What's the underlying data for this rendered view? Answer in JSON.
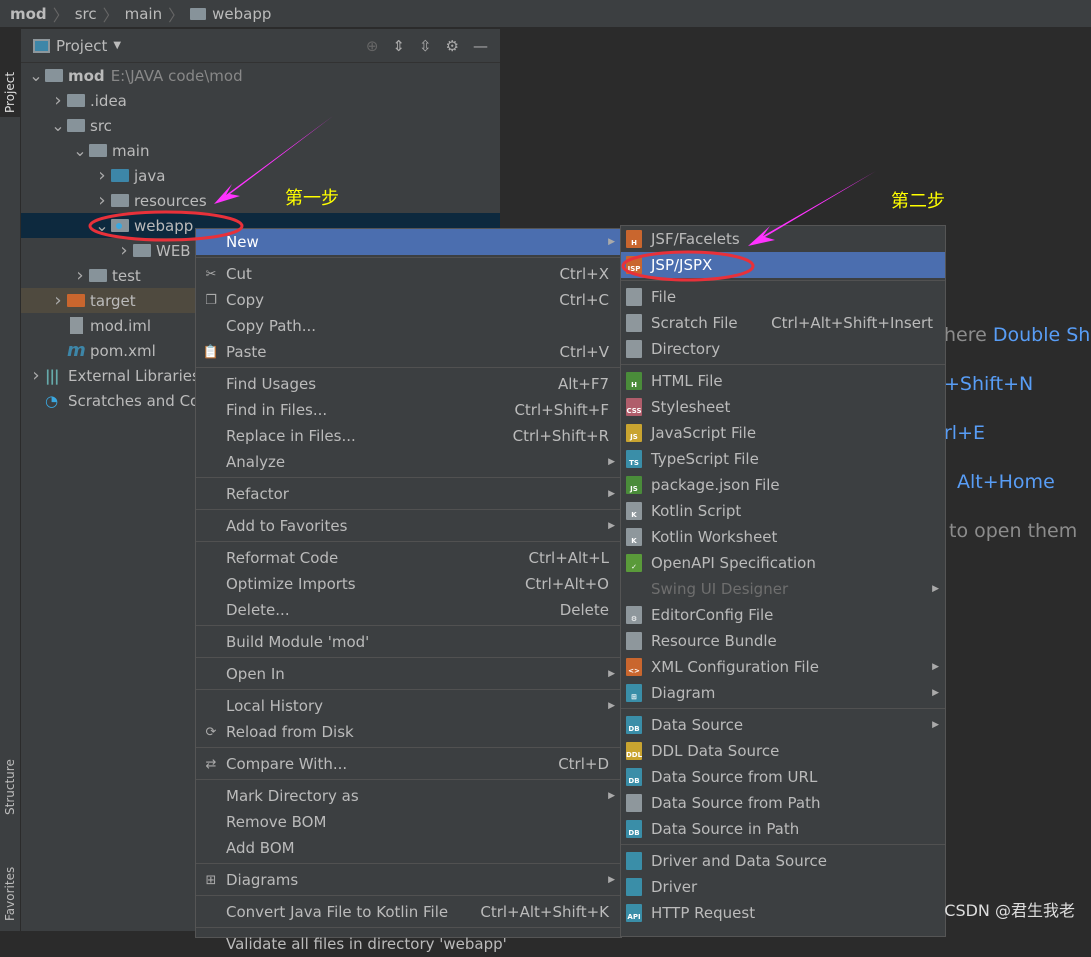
{
  "breadcrumb": [
    "mod",
    "src",
    "main",
    "webapp"
  ],
  "left_stripe": {
    "project": "Project",
    "structure": "Structure",
    "favorites": "Favorites"
  },
  "panel": {
    "title": "Project",
    "tools": [
      "locate-icon",
      "expand-all-icon",
      "collapse-all-icon",
      "gear-icon",
      "minimize-icon"
    ]
  },
  "tree": [
    {
      "label": "mod",
      "extra": "E:\\JAVA code\\mod",
      "indent": 0,
      "arrow": "down",
      "icon": "module",
      "bold": true
    },
    {
      "label": ".idea",
      "indent": 1,
      "arrow": "right",
      "icon": "folder"
    },
    {
      "label": "src",
      "indent": 1,
      "arrow": "down",
      "icon": "folder"
    },
    {
      "label": "main",
      "indent": 2,
      "arrow": "down",
      "icon": "folder"
    },
    {
      "label": "java",
      "indent": 3,
      "arrow": "right",
      "icon": "folder-blue"
    },
    {
      "label": "resources",
      "indent": 3,
      "arrow": "right",
      "icon": "folder"
    },
    {
      "label": "webapp",
      "indent": 3,
      "arrow": "down",
      "icon": "folder-web",
      "selected": true
    },
    {
      "label": "WEB",
      "indent": 4,
      "arrow": "right",
      "icon": "folder"
    },
    {
      "label": "test",
      "indent": 2,
      "arrow": "right",
      "icon": "folder"
    },
    {
      "label": "target",
      "indent": 1,
      "arrow": "right",
      "icon": "folder-orange",
      "excluded": true
    },
    {
      "label": "mod.iml",
      "indent": 1,
      "arrow": "",
      "icon": "file"
    },
    {
      "label": "pom.xml",
      "indent": 1,
      "arrow": "",
      "icon": "maven"
    },
    {
      "label": "External Libraries",
      "indent": 0,
      "arrow": "right",
      "icon": "libraries"
    },
    {
      "label": "Scratches and Co",
      "indent": 0,
      "arrow": "",
      "icon": "scratches"
    }
  ],
  "context_menu": [
    {
      "label": "New",
      "submenu": true,
      "highlighted": true
    },
    "sep",
    {
      "label": "Cut",
      "shortcut": "Ctrl+X",
      "icon": "✂"
    },
    {
      "label": "Copy",
      "shortcut": "Ctrl+C",
      "icon": "❐"
    },
    {
      "label": "Copy Path...",
      "shortcut": ""
    },
    {
      "label": "Paste",
      "shortcut": "Ctrl+V",
      "icon": "📋"
    },
    "sep",
    {
      "label": "Find Usages",
      "shortcut": "Alt+F7"
    },
    {
      "label": "Find in Files...",
      "shortcut": "Ctrl+Shift+F"
    },
    {
      "label": "Replace in Files...",
      "shortcut": "Ctrl+Shift+R"
    },
    {
      "label": "Analyze",
      "submenu": true
    },
    "sep",
    {
      "label": "Refactor",
      "submenu": true
    },
    "sep",
    {
      "label": "Add to Favorites",
      "submenu": true
    },
    "sep",
    {
      "label": "Reformat Code",
      "shortcut": "Ctrl+Alt+L"
    },
    {
      "label": "Optimize Imports",
      "shortcut": "Ctrl+Alt+O"
    },
    {
      "label": "Delete...",
      "shortcut": "Delete"
    },
    "sep",
    {
      "label": "Build Module 'mod'"
    },
    "sep",
    {
      "label": "Open In",
      "submenu": true
    },
    "sep",
    {
      "label": "Local History",
      "submenu": true
    },
    {
      "label": "Reload from Disk",
      "icon": "⟳"
    },
    "sep",
    {
      "label": "Compare With...",
      "shortcut": "Ctrl+D",
      "icon": "⇄"
    },
    "sep",
    {
      "label": "Mark Directory as",
      "submenu": true
    },
    {
      "label": "Remove BOM"
    },
    {
      "label": "Add BOM"
    },
    "sep",
    {
      "label": "Diagrams",
      "submenu": true,
      "icon": "⊞"
    },
    "sep",
    {
      "label": "Convert Java File to Kotlin File",
      "shortcut": "Ctrl+Alt+Shift+K"
    },
    "sep",
    {
      "label": "Validate all files in directory 'webapp'"
    }
  ],
  "new_submenu": [
    {
      "label": "JSF/Facelets",
      "badge": "H",
      "color": "#c9662e"
    },
    {
      "label": "JSP/JSPX",
      "badge": "JSP",
      "color": "#c9662e",
      "highlighted": true
    },
    "sep",
    {
      "label": "File",
      "badge": "",
      "color": "#8e979c"
    },
    {
      "label": "Scratch File",
      "shortcut": "Ctrl+Alt+Shift+Insert",
      "badge": "",
      "color": "#8e979c"
    },
    {
      "label": "Directory",
      "badge": "",
      "color": "#8e979c"
    },
    "sep",
    {
      "label": "HTML File",
      "badge": "H",
      "color": "#4a8c3a"
    },
    {
      "label": "Stylesheet",
      "badge": "CSS",
      "color": "#b05d6b"
    },
    {
      "label": "JavaScript File",
      "badge": "JS",
      "color": "#c9a430"
    },
    {
      "label": "TypeScript File",
      "badge": "TS",
      "color": "#3a8ea8"
    },
    {
      "label": "package.json File",
      "badge": "JS",
      "color": "#4a8c3a"
    },
    {
      "label": "Kotlin Script",
      "badge": "K",
      "color": "#8e979c"
    },
    {
      "label": "Kotlin Worksheet",
      "badge": "K",
      "color": "#8e979c"
    },
    {
      "label": "OpenAPI Specification",
      "badge": "✓",
      "color": "#5a9a3a"
    },
    {
      "label": "Swing UI Designer",
      "disabled": true,
      "submenu": true
    },
    {
      "label": "EditorConfig File",
      "badge": "⚙",
      "color": "#8e979c"
    },
    {
      "label": "Resource Bundle",
      "badge": "",
      "color": "#8e979c"
    },
    {
      "label": "XML Configuration File",
      "badge": "<>",
      "color": "#c9662e",
      "submenu": true
    },
    {
      "label": "Diagram",
      "badge": "⊞",
      "color": "#3a8ea8",
      "submenu": true
    },
    "sep",
    {
      "label": "Data Source",
      "badge": "DB",
      "color": "#3a8ea8",
      "submenu": true
    },
    {
      "label": "DDL Data Source",
      "badge": "DDL",
      "color": "#c9a430"
    },
    {
      "label": "Data Source from URL",
      "badge": "DB",
      "color": "#3a8ea8"
    },
    {
      "label": "Data Source from Path",
      "badge": "",
      "color": "#8e979c"
    },
    {
      "label": "Data Source in Path",
      "badge": "DB",
      "color": "#3a8ea8"
    },
    "sep",
    {
      "label": "Driver and Data Source",
      "badge": "",
      "color": "#3a8ea8"
    },
    {
      "label": "Driver",
      "badge": "",
      "color": "#3a8ea8"
    },
    {
      "label": "HTTP Request",
      "badge": "API",
      "color": "#3a8ea8"
    }
  ],
  "editor_hints": [
    {
      "text": "here",
      "shortcut": "Double Sh"
    },
    {
      "text": "",
      "shortcut": "+Shift+N"
    },
    {
      "text": "",
      "shortcut": "rl+E"
    },
    {
      "text": "",
      "shortcut": "Alt+Home"
    },
    {
      "text": "to open them",
      "shortcut": ""
    }
  ],
  "annotations": {
    "step1": "第一步",
    "step2": "第二步",
    "arrow_color": "#ff33ff",
    "circle_color": "#e8313a"
  },
  "watermark": "CSDN @君生我老"
}
